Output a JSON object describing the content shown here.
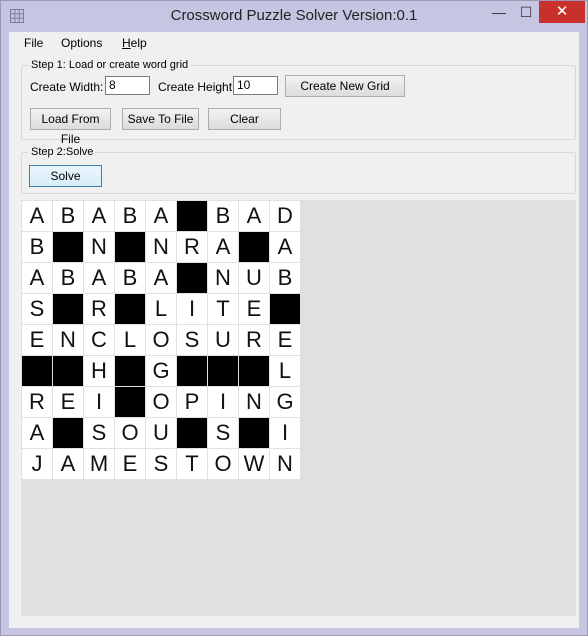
{
  "window": {
    "title": "Crossword Puzzle Solver Version:0.1",
    "minimize_glyph": "—",
    "maximize_glyph": "☐",
    "close_glyph": "✕"
  },
  "menu": {
    "file": "File",
    "options": "Options",
    "help_first": "H",
    "help_rest": "elp"
  },
  "step1": {
    "legend": "Step 1: Load or create word grid",
    "width_label": "Create Width:",
    "width_value": "8",
    "height_label": "Create Height:",
    "height_value": "10",
    "create_button": "Create New Grid",
    "load_button": "Load From File",
    "save_button": "Save To File",
    "clear_button": "Clear"
  },
  "step2": {
    "legend": "Step 2:Solve",
    "solve_button": "Solve"
  },
  "grid": {
    "rows": [
      "ABABA#BAD",
      "B#N#NRA#A",
      "ABABA#NUB",
      "S#R#LITE#",
      "ENCLOSURE",
      "##H#G###L",
      "REI#OPING",
      "A#SOU#S#I",
      "JAMESTOWN"
    ],
    "black_marker": "#"
  },
  "colors": {
    "close_button": "#c7302b",
    "window_frame": "#c6c6e2",
    "client_background": "#f0f0f0",
    "grid_panel": "#e0e0e0",
    "black_cell": "#000000"
  }
}
